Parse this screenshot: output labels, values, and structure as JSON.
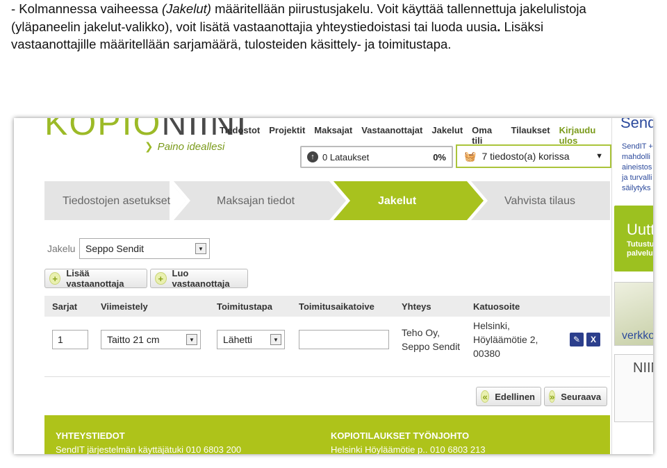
{
  "caption": {
    "line1_pre": "- Kolmannessa vaiheessa ",
    "line1_em": "(Jakelut)",
    "line1_post": " määritellään piirustusjakelu. Voit käyttää tallennettuja jakelulistoja",
    "line2": "(yläpaneelin jakelut-valikko), voit lisätä vastaanottajia yhteystiedoistasi tai luoda uusia",
    "line2_bold": ".",
    "line2_post": " Lisäksi",
    "line3": "vastaanottajille määritellään sarjamäärä, tulosteiden käsittely- ja toimitustapa."
  },
  "header": {
    "logo_left": "KOPIO",
    "logo_right": "NIINI",
    "slogan": "Paino ideallesi",
    "nav": [
      "Tiedostot",
      "Projektit",
      "Maksajat",
      "Vastaanottajat",
      "Jakelut",
      "Oma tili",
      "Tilaukset"
    ],
    "login": "Kirjaudu ulos",
    "downloads_label": "0 Lataukset",
    "downloads_pct": "0%",
    "cart_label": "7 tiedosto(a) korissa"
  },
  "steps": [
    "Tiedostojen asetukset",
    "Maksajan tiedot",
    "Jakelut",
    "Vahvista tilaus"
  ],
  "form": {
    "jakelu_label": "Jakelu",
    "jakelu_value": "Seppo Sendit",
    "add_button": "Lisää vastaanottaja",
    "create_button": "Luo vastaanottaja"
  },
  "table": {
    "headers": [
      "Sarjat",
      "Viimeistely",
      "Toimitustapa",
      "Toimitusaikatoive",
      "Yhteys",
      "Katuosoite"
    ],
    "row": {
      "sarjat": "1",
      "viimeistely": "Taitto 21 cm",
      "toimitustapa": "Lähetti",
      "toimitusaikatoive": "",
      "yhteys_1": "Teho Oy,",
      "yhteys_2": "Seppo Sendit",
      "osoite_1": "Helsinki,",
      "osoite_2": "Höyläämötie 2,",
      "osoite_3": "00380"
    }
  },
  "nav_buttons": {
    "prev": "Edellinen",
    "next": "Seuraava"
  },
  "footer": {
    "left_title": "YHTEYSTIEDOT",
    "left_text": "SendIT järjestelmän käyttäjätuki 010 6803 200",
    "right_title": "KOPIOTILAUKSET TYÖNJOHTO",
    "right_text": "Helsinki Höyläämötie p.. 010 6803 213"
  },
  "sidebar": {
    "top": "Send",
    "text": [
      "SendIT +",
      "mahdolli",
      "aineistos",
      "ja turvalli",
      "säilytyks"
    ],
    "banner_big": "Uutt",
    "banner_small_1": "Tutustu",
    "banner_small_2": "palvelu",
    "paper_label": "verkko",
    "niin_label": "NIIN"
  },
  "colors": {
    "brand_green": "#9cba27",
    "footer_green": "#aec31a",
    "edit_blue": "#2c3f8c"
  }
}
